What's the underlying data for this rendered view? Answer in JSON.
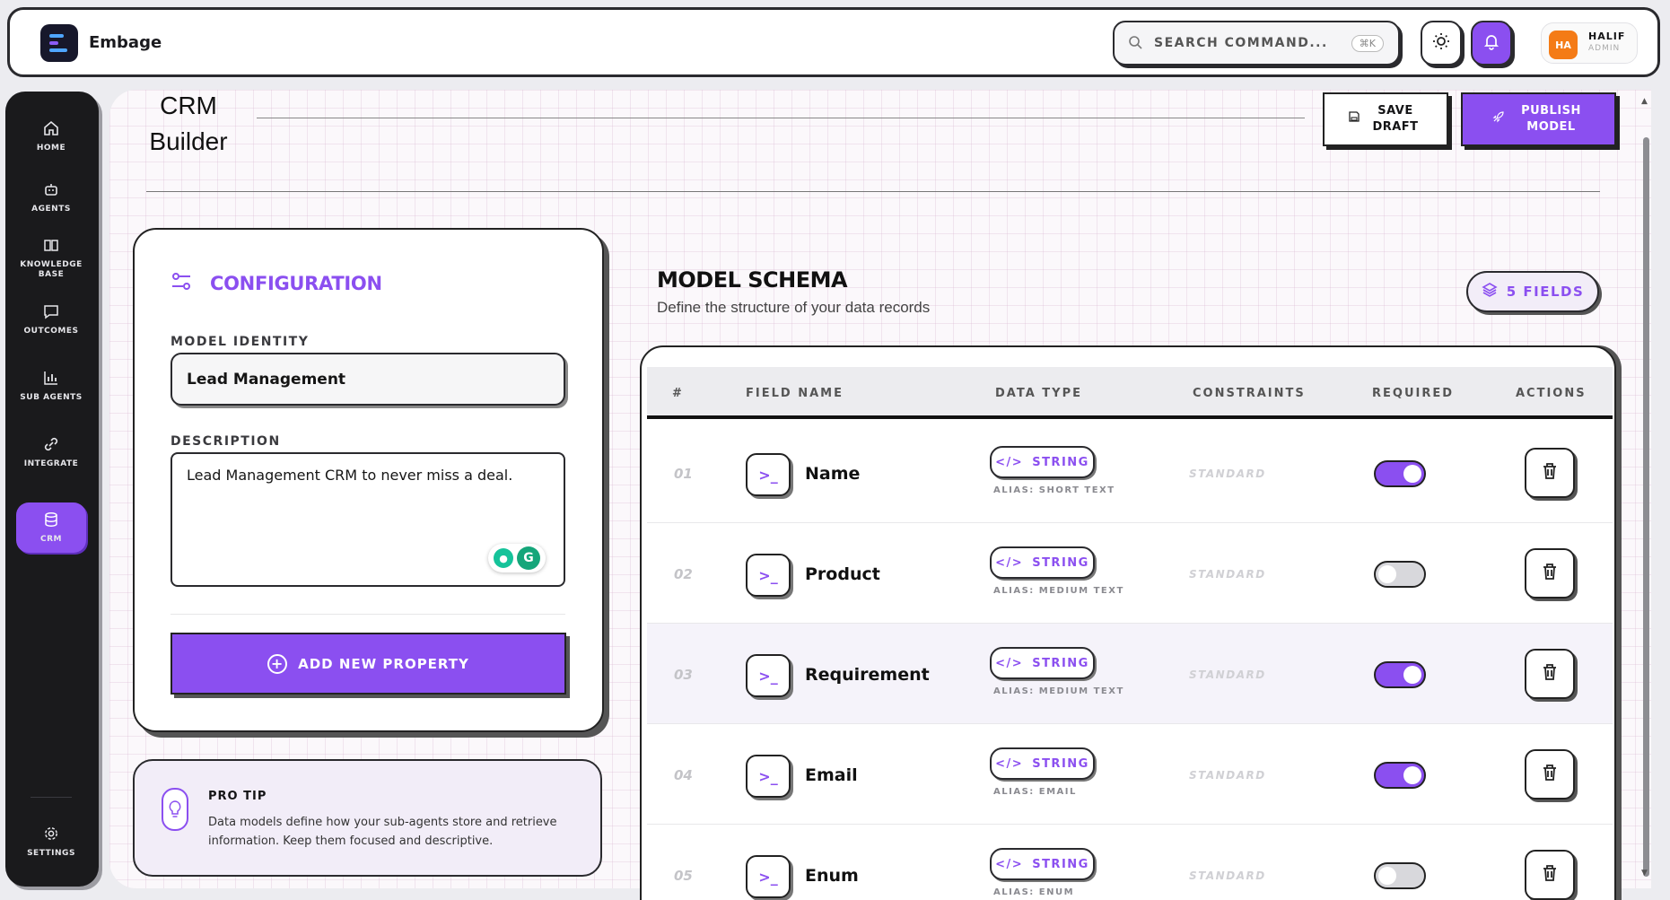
{
  "app": {
    "brand": "Embage"
  },
  "topbar": {
    "search_placeholder": "SEARCH COMMAND...",
    "search_shortcut": "⌘K",
    "user": {
      "initials": "HA",
      "name": "HALIF",
      "role": "ADMIN"
    }
  },
  "sidebar": {
    "items": [
      {
        "label": "HOME",
        "icon": "home-icon",
        "active": false
      },
      {
        "label": "AGENTS",
        "icon": "robot-icon",
        "active": false
      },
      {
        "label": "KNOWLEDGE BASE",
        "icon": "book-icon",
        "active": false
      },
      {
        "label": "OUTCOMES",
        "icon": "message-icon",
        "active": false
      },
      {
        "label": "SUB AGENTS",
        "icon": "chart-icon",
        "active": false
      },
      {
        "label": "INTEGRATE",
        "icon": "link-icon",
        "active": false
      },
      {
        "label": "CRM",
        "icon": "database-icon",
        "active": true
      }
    ],
    "settings_label": "SETTINGS"
  },
  "header": {
    "title": "CRM Builder",
    "save_label": "SAVE DRAFT",
    "publish_label": "PUBLISH MODEL"
  },
  "config": {
    "title": "CONFIGURATION",
    "identity_label": "MODEL IDENTITY",
    "identity_value": "Lead Management",
    "description_label": "DESCRIPTION",
    "description_value": "Lead Management CRM to never miss a deal.",
    "add_button_label": "ADD NEW PROPERTY"
  },
  "tip": {
    "title": "PRO TIP",
    "text": "Data models define how your sub-agents store and retrieve information. Keep them focused and descriptive."
  },
  "schema": {
    "title": "MODEL SCHEMA",
    "subtitle": "Define the structure of your data records",
    "fields_badge": "5 FIELDS",
    "columns": [
      "#",
      "FIELD NAME",
      "DATA TYPE",
      "CONSTRAINTS",
      "REQUIRED",
      "ACTIONS"
    ],
    "rows": [
      {
        "num": "01",
        "name": "Name",
        "type": "STRING",
        "alias": "ALIAS: SHORT TEXT",
        "constraint": "STANDARD",
        "required": true
      },
      {
        "num": "02",
        "name": "Product",
        "type": "STRING",
        "alias": "ALIAS: MEDIUM TEXT",
        "constraint": "STANDARD",
        "required": false
      },
      {
        "num": "03",
        "name": "Requirement",
        "type": "STRING",
        "alias": "ALIAS: MEDIUM TEXT",
        "constraint": "STANDARD",
        "required": true
      },
      {
        "num": "04",
        "name": "Email",
        "type": "STRING",
        "alias": "ALIAS: EMAIL",
        "constraint": "STANDARD",
        "required": true
      },
      {
        "num": "05",
        "name": "Enum",
        "type": "STRING",
        "alias": "ALIAS: ENUM",
        "constraint": "STANDARD",
        "required": false
      }
    ]
  },
  "colors": {
    "accent": "#8b4ff0",
    "dark": "#1a1a1c",
    "avatar": "#f47b16"
  }
}
